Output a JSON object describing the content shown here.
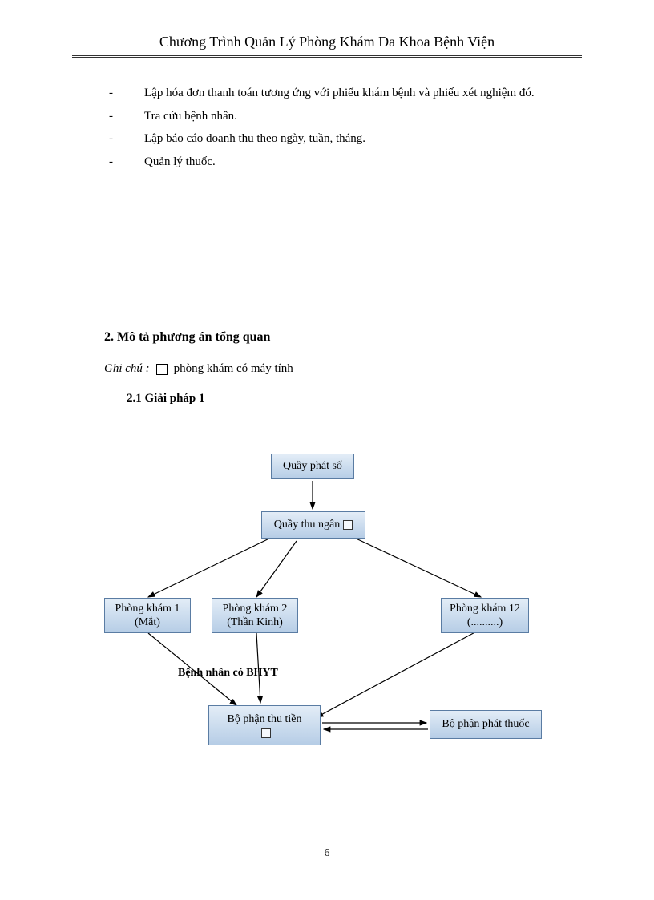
{
  "header": {
    "title": "Chương Trình Quản Lý Phòng Khám Đa Khoa Bệnh Viện"
  },
  "bullets": [
    "Lập hóa đơn thanh toán tương ứng với phiếu khám bệnh và phiếu xét nghiệm đó.",
    "Tra cứu bệnh nhân.",
    "Lập báo cáo doanh thu theo ngày, tuần, tháng.",
    "Quản lý thuốc."
  ],
  "section2": {
    "heading": "2.  Mô tả phương án tổng quan",
    "note_prefix": "Ghi chú :",
    "note_suffix": "phòng khám có máy tính",
    "sub": "2.1 Giải pháp 1"
  },
  "diagram": {
    "nodes": {
      "quay_phat_so": "Quầy phát số",
      "quay_thu_ngan": "Quầy thu ngân",
      "pk1_line1": "Phòng khám 1",
      "pk1_line2": "(Mắt)",
      "pk2_line1": "Phòng khám 2",
      "pk2_line2": "(Thần Kinh)",
      "pk12_line1": "Phòng khám 12",
      "pk12_line2": "(..........)",
      "bo_phan_thu_tien": "Bộ phận thu tiền",
      "bo_phan_phat_thuoc": "Bộ phận phát thuốc"
    },
    "edge_label": "Bệnh nhân có BHYT"
  },
  "page_number": "6"
}
